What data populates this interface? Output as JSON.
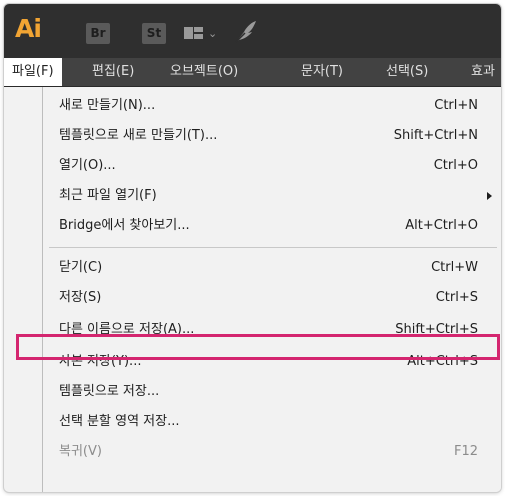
{
  "app": {
    "logo": "Ai",
    "bridge_label": "Br",
    "stock_label": "St",
    "workspace_chevron": "⌄",
    "icons": [
      "workspace-icon",
      "feather-icon"
    ]
  },
  "menubar": {
    "items": [
      {
        "label": "파일(F)",
        "active": true
      },
      {
        "label": "편집(E)"
      },
      {
        "label": "오브젝트(O)"
      },
      {
        "label": "문자(T)"
      },
      {
        "label": "선택(S)"
      },
      {
        "label": "효과"
      }
    ]
  },
  "file_menu": {
    "items": [
      {
        "label": "새로 만들기(N)...",
        "shortcut": "Ctrl+N"
      },
      {
        "label": "템플릿으로 새로 만들기(T)...",
        "shortcut": "Shift+Ctrl+N"
      },
      {
        "label": "열기(O)...",
        "shortcut": "Ctrl+O"
      },
      {
        "label": "최근 파일 열기(F)",
        "shortcut": ""
      },
      {
        "label": "Bridge에서 찾아보기...",
        "shortcut": "Alt+Ctrl+O"
      },
      {
        "label": "닫기(C)",
        "shortcut": "Ctrl+W"
      },
      {
        "label": "저장(S)",
        "shortcut": "Ctrl+S"
      },
      {
        "label": "다른 이름으로 저장(A)...",
        "shortcut": "Shift+Ctrl+S",
        "highlighted": true
      },
      {
        "label": "사본 저장(Y)...",
        "shortcut": "Alt+Ctrl+S"
      },
      {
        "label": "템플릿으로 저장...",
        "shortcut": ""
      },
      {
        "label": "선택 분할 영역 저장...",
        "shortcut": ""
      },
      {
        "label": "복귀(V)",
        "shortcut": "F12",
        "disabled": true
      }
    ]
  },
  "colors": {
    "app_bar": "#2f2f2f",
    "menubar": "#424242",
    "ai_logo": "#f1a433",
    "highlight_border": "#d4266f",
    "menu_bg": "#f2f2f2"
  }
}
